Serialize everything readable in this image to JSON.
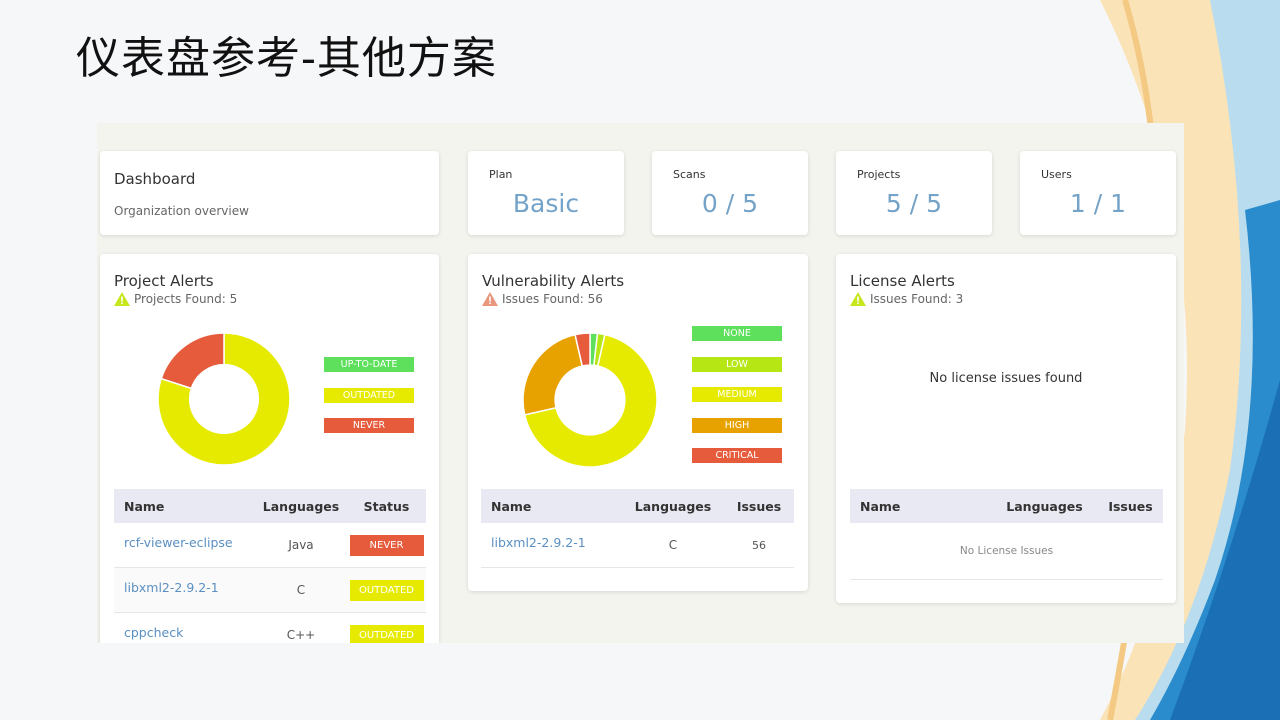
{
  "slide": {
    "title": "仪表盘参考-其他方案"
  },
  "overview": {
    "title": "Dashboard",
    "subtitle": "Organization overview"
  },
  "stats": [
    {
      "label": "Plan",
      "value": "Basic"
    },
    {
      "label": "Scans",
      "value": "0 / 5"
    },
    {
      "label": "Projects",
      "value": "5 / 5"
    },
    {
      "label": "Users",
      "value": "1 / 1"
    }
  ],
  "colors": {
    "accent": "#74a3c9",
    "up_to_date": "#5ee05c",
    "none": "#5ee05c",
    "low": "#b6e613",
    "medium": "#e6ea00",
    "high": "#e8a200",
    "never": "#e55b3c",
    "critical": "#e55b3c",
    "warn_yellow": "#c8e61e",
    "warn_red": "#e8967c"
  },
  "project_alerts": {
    "title": "Project Alerts",
    "summary": "Projects Found: 5",
    "legend": [
      "UP-TO-DATE",
      "OUTDATED",
      "NEVER"
    ],
    "chart": [
      {
        "label": "UP-TO-DATE",
        "value": 0
      },
      {
        "label": "OUTDATED",
        "value": 4
      },
      {
        "label": "NEVER",
        "value": 1
      }
    ],
    "columns": [
      "Name",
      "Languages",
      "Status"
    ],
    "rows": [
      {
        "name": "rcf-viewer-eclipse",
        "language": "Java",
        "status": "NEVER"
      },
      {
        "name": "libxml2-2.9.2-1",
        "language": "C",
        "status": "OUTDATED"
      },
      {
        "name": "cppcheck",
        "language": "C++",
        "status": "OUTDATED"
      }
    ]
  },
  "vulnerability_alerts": {
    "title": "Vulnerability Alerts",
    "summary": "Issues Found: 56",
    "legend": [
      "NONE",
      "LOW",
      "MEDIUM",
      "HIGH",
      "CRITICAL"
    ],
    "chart": [
      {
        "label": "NONE",
        "value": 1
      },
      {
        "label": "LOW",
        "value": 1
      },
      {
        "label": "MEDIUM",
        "value": 38
      },
      {
        "label": "HIGH",
        "value": 14
      },
      {
        "label": "CRITICAL",
        "value": 2
      }
    ],
    "columns": [
      "Name",
      "Languages",
      "Issues"
    ],
    "rows": [
      {
        "name": "libxml2-2.9.2-1",
        "language": "C",
        "issues": "56"
      }
    ]
  },
  "license_alerts": {
    "title": "License Alerts",
    "summary": "Issues Found: 3",
    "empty_chart_text": "No license issues found",
    "columns": [
      "Name",
      "Languages",
      "Issues"
    ],
    "empty_table_text": "No License Issues"
  }
}
